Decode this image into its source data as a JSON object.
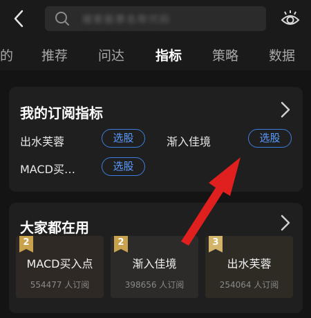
{
  "header": {
    "search_placeholder": "搜索股票名称代码",
    "back_icon": "chevron-left-icon",
    "eye_icon": "eye-icon"
  },
  "tabs": [
    {
      "label": "的"
    },
    {
      "label": "推荐"
    },
    {
      "label": "问达"
    },
    {
      "label": "指标",
      "active": true
    },
    {
      "label": "策略"
    },
    {
      "label": "数据"
    }
  ],
  "subscribed": {
    "title": "我的订阅指标",
    "items": [
      {
        "name": "出水芙蓉",
        "action": "选股"
      },
      {
        "name": "渐入佳境",
        "action": "选股"
      },
      {
        "name": "MACD买…",
        "action": "选股"
      }
    ]
  },
  "popular": {
    "title": "大家都在用",
    "items": [
      {
        "rank": "2",
        "name": "MACD买入点",
        "count": "554477 人订阅"
      },
      {
        "rank": "2",
        "name": "渐入佳境",
        "count": "398656 人订阅"
      },
      {
        "rank": "3",
        "name": "出水芙蓉",
        "count": "254064 人订阅"
      }
    ]
  },
  "colors": {
    "accent_blue": "#3d7fe0",
    "badge_gold": "#c9a24e",
    "annotation_red": "#e0201f"
  }
}
